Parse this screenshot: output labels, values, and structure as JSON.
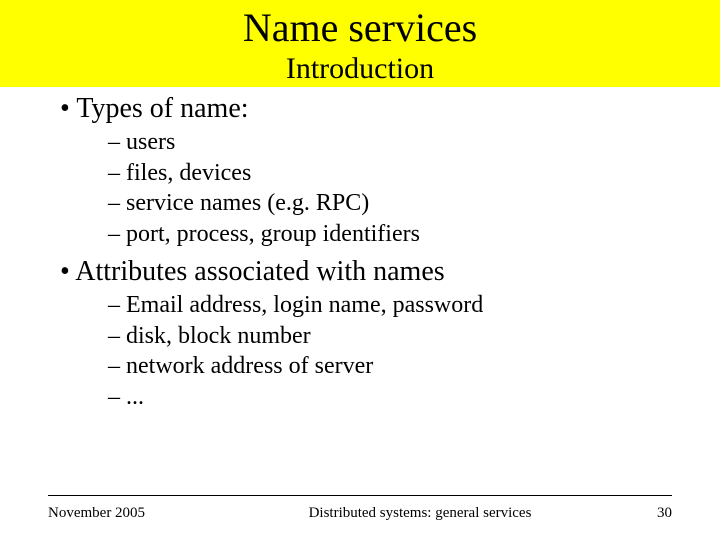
{
  "header": {
    "title": "Name services",
    "subtitle": "Introduction"
  },
  "content": {
    "bullets": [
      {
        "text": "Types of name:",
        "subs": [
          "users",
          "files, devices",
          "service names (e.g. RPC)",
          "port, process, group identifiers"
        ]
      },
      {
        "text": "Attributes associated with names",
        "subs": [
          "Email address, login name, password",
          "disk, block number",
          "network address of server",
          "..."
        ]
      }
    ]
  },
  "footer": {
    "date": "November 2005",
    "course": "Distributed systems: general services",
    "page": "30"
  },
  "marks": {
    "bullet": "•",
    "dash": "–"
  }
}
